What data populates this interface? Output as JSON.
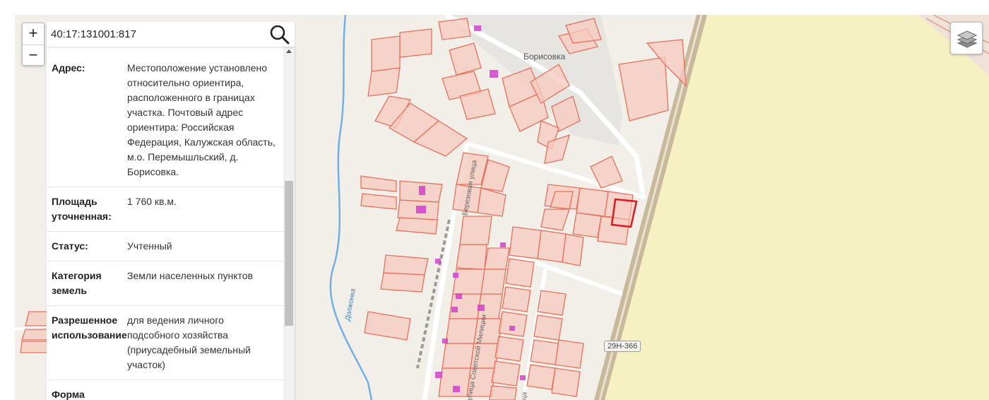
{
  "search": {
    "value": "40:17:131001:817",
    "placeholder": ""
  },
  "zoom": {
    "in_label": "+",
    "out_label": "−"
  },
  "icons": {
    "search": "search-icon",
    "layers": "layers-icon",
    "scroll_up": "chevron-up-icon"
  },
  "info": {
    "rows": [
      {
        "label": "Адрес:",
        "value": "Местоположение установлено относительно ориентира, расположенного в границах участка. Почтовый адрес ориентира: Российская Федерация, Калужская область, м.о. Перемышльский, д. Борисовка."
      },
      {
        "label": "Площадь уточненная:",
        "value": "1 760 кв.м."
      },
      {
        "label": "Статус:",
        "value": "Учтенный"
      },
      {
        "label": "Категория земель",
        "value": "Земли населенных пунктов"
      },
      {
        "label": "Разрешенное использование",
        "value": "для ведения личного подсобного хозяйства (приусадебный земельный участок)"
      },
      {
        "label": "Форма",
        "value": ""
      }
    ]
  },
  "map": {
    "village_label": "Борисовка",
    "road_label": "29Н-366",
    "street_1": "Березовая улица",
    "street_2": "улица Советской Милиции",
    "street_3": "улица",
    "river_label": "Должонка",
    "colors": {
      "background": "#f2efe9",
      "field": "#f5f1c3",
      "parcel_fill": "#f7c9bd",
      "parcel_stroke": "#e8705a",
      "selected_parcel": "#e5161b",
      "building": "#d63fd1",
      "river": "#6fb0e8",
      "road": "#c8b99a"
    }
  }
}
